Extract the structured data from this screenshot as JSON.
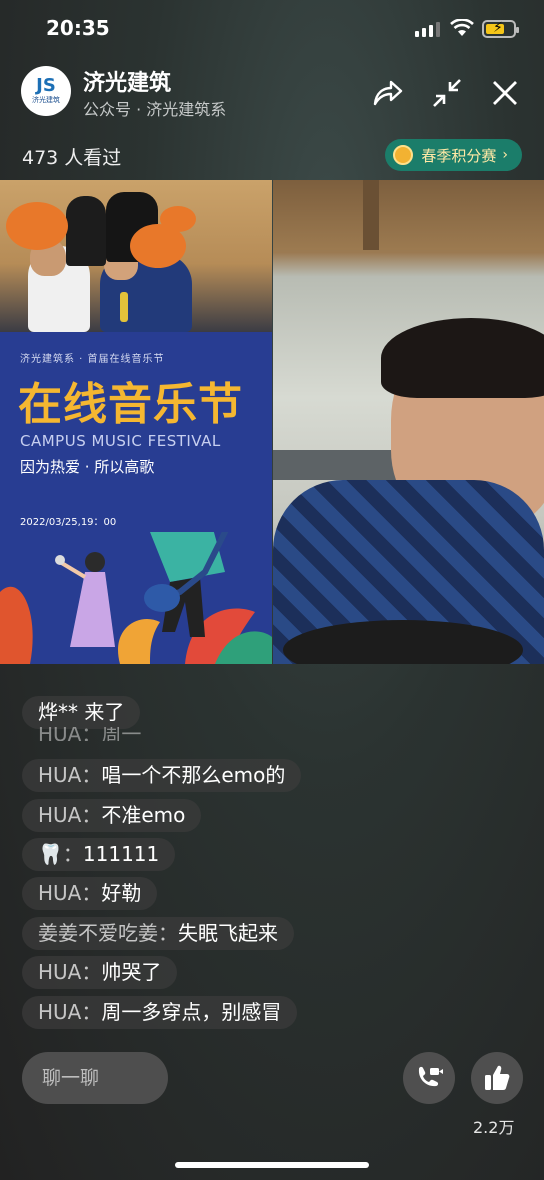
{
  "status_bar": {
    "time": "20:35"
  },
  "header": {
    "avatar_logo": "JS",
    "avatar_text": "济光建筑",
    "title": "济光建筑",
    "subtitle": "公众号 · 济光建筑系"
  },
  "viewers": "473 人看过",
  "contest_label": "春季积分赛",
  "poster": {
    "kicker": "济光建筑系 · 首届在线音乐节",
    "big_title": "在线音乐节",
    "english": "CAMPUS MUSIC FESTIVAL",
    "slogan": "因为热爱 · 所以高歌",
    "date": "2022/03/25,19：00"
  },
  "comments": [
    {
      "user": "烨** 来了",
      "text": ""
    },
    {
      "user": "HUA：",
      "text": "唱一个不那么emo的"
    },
    {
      "user": "HUA：",
      "text": "不准emo"
    },
    {
      "user": "🦷：",
      "text": "111111"
    },
    {
      "user": "HUA：",
      "text": "好勒"
    },
    {
      "user": "姜姜不爱吃姜：",
      "text": "失眠飞起来"
    },
    {
      "user": "HUA：",
      "text": "帅哭了"
    },
    {
      "user": "HUA：",
      "text": "周一多穿点，别感冒"
    }
  ],
  "faded_comment": "HUA：周一",
  "chat_placeholder": "聊一聊",
  "like_count": "2.2万",
  "colors": {
    "contest_bg": "#1b7d6a",
    "poster_bg": "#283d92",
    "poster_title": "#f5b731"
  },
  "icons": [
    "share-icon",
    "shrink-icon",
    "close-icon",
    "video-call-icon",
    "thumbs-up-icon"
  ]
}
